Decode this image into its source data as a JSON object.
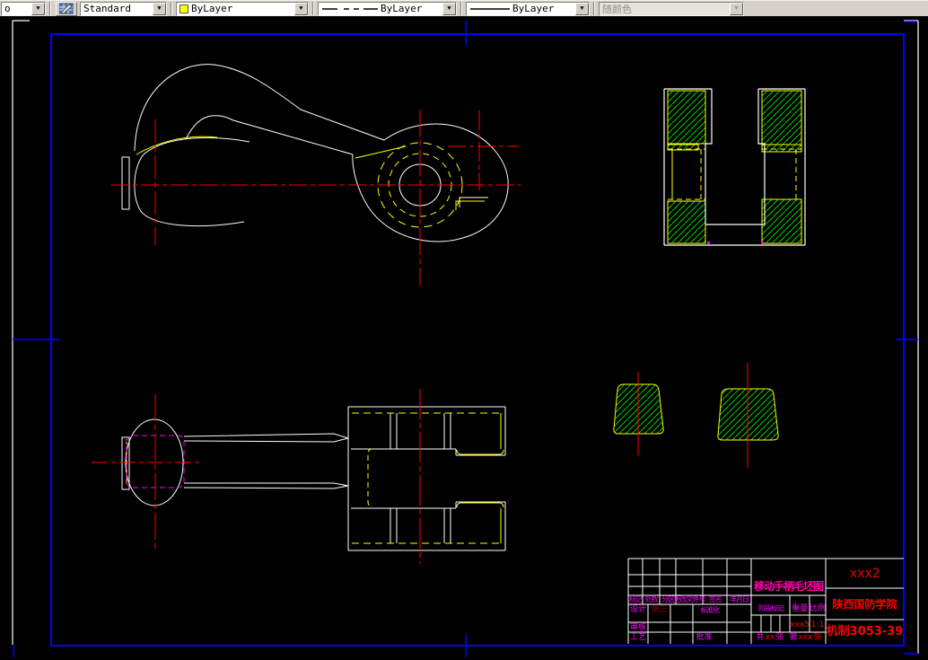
{
  "toolbar": {
    "partial_combo_value": "o",
    "style_combo_value": "Standard",
    "color_combo_value": "ByLayer",
    "color_swatch": "#ffff00",
    "linetype_combo_value": "ByLayer",
    "lineweight_combo_value": "ByLayer",
    "plotstyle_combo_value": "随颜色",
    "arrow_glyph": "▼"
  },
  "palette": {
    "toolbar_bg": "#d4d0c8",
    "canvas_bg": "#000000",
    "frame_blue": "#0000ff",
    "sheet_white": "#ffffff",
    "outline_white": "#ffffff",
    "hidden_yellow": "#ffff00",
    "center_red": "#ff0000",
    "hatch_green": "#00d200",
    "hidden_magenta": "#ff00ff",
    "title_pink": "#ff00aa"
  },
  "title_block": {
    "title": "移动手柄毛坯图",
    "code_top": "xxx2",
    "company": "陕西国防学院",
    "code_bottom": "机制3053-39",
    "header_labels": [
      "标记",
      "处数",
      "分区",
      "更改文件号",
      "签名",
      "年月日"
    ],
    "design_label": "设计",
    "designer_name": "张三",
    "standardization_label": "标准化",
    "check_label": "审核",
    "process_label": "工艺",
    "approve_label": "批准",
    "stage_label": "阶段标记",
    "weight_label": "重量",
    "scale_label": "比例",
    "weight_value": "xxx5",
    "scale_value": "1:1",
    "sheet_info": {
      "p1": "共",
      "p2": "xx",
      "p3": "张",
      "p4": "第",
      "p5": "xxx",
      "p6": "张"
    }
  }
}
